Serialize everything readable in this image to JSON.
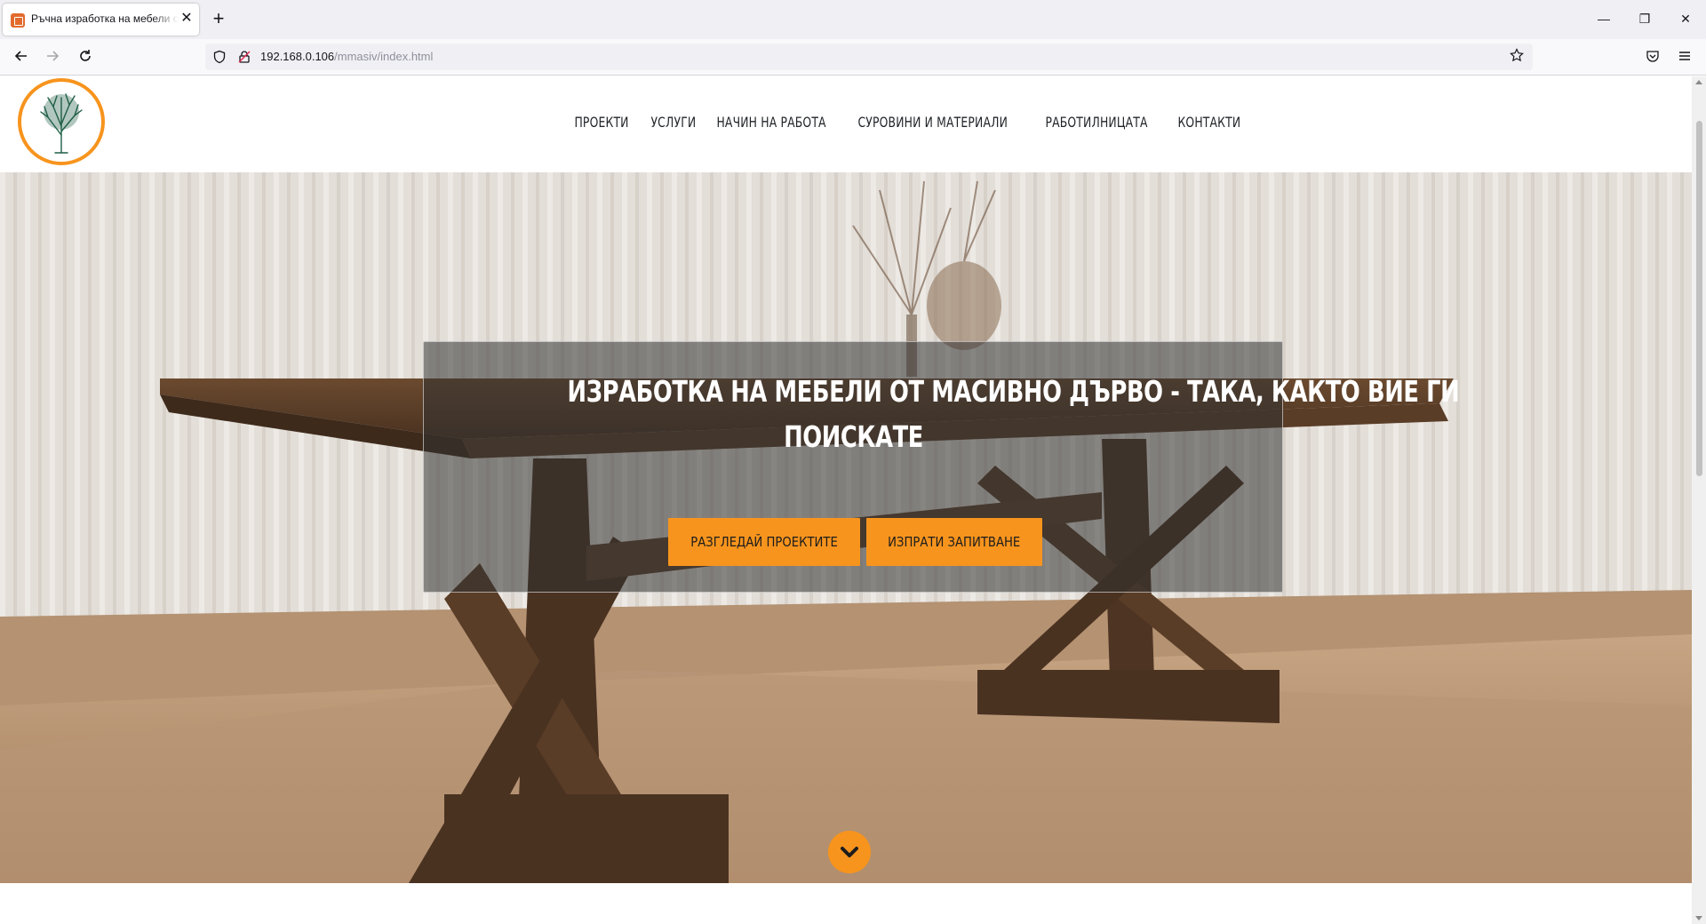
{
  "browser": {
    "tab_title": "Ръчна изработка на мебели от масивно дърво",
    "tab_close": "✕",
    "new_tab": "+",
    "window_minimize": "—",
    "window_restore": "❐",
    "window_close": "✕",
    "url_host": "192.168.0.106",
    "url_path": "/mmasiv/index.html"
  },
  "site": {
    "menu": [
      {
        "label": "ПРОЕКТИ"
      },
      {
        "label": "УСЛУГИ"
      },
      {
        "label": "НАЧИН НА РАБОТА"
      },
      {
        "label": "СУРОВИНИ И МАТЕРИАЛИ"
      },
      {
        "label": "РАБОТИЛНИЦАТА"
      },
      {
        "label": "КОНТАКТИ"
      }
    ],
    "hero": {
      "title_line1": "ИЗРАБОТКА НА МЕБЕЛИ ОТ МАСИВНО ДЪРВО - ТАКА, КАКТО ВИЕ ГИ",
      "title_line2": "ПОИСКАТЕ",
      "btn_projects": "РАЗГЛЕДАЙ ПРОЕКТИТЕ",
      "btn_inquiry": "ИЗПРАТИ ЗАПИТВАНЕ"
    },
    "accent_color": "#f7941d"
  }
}
